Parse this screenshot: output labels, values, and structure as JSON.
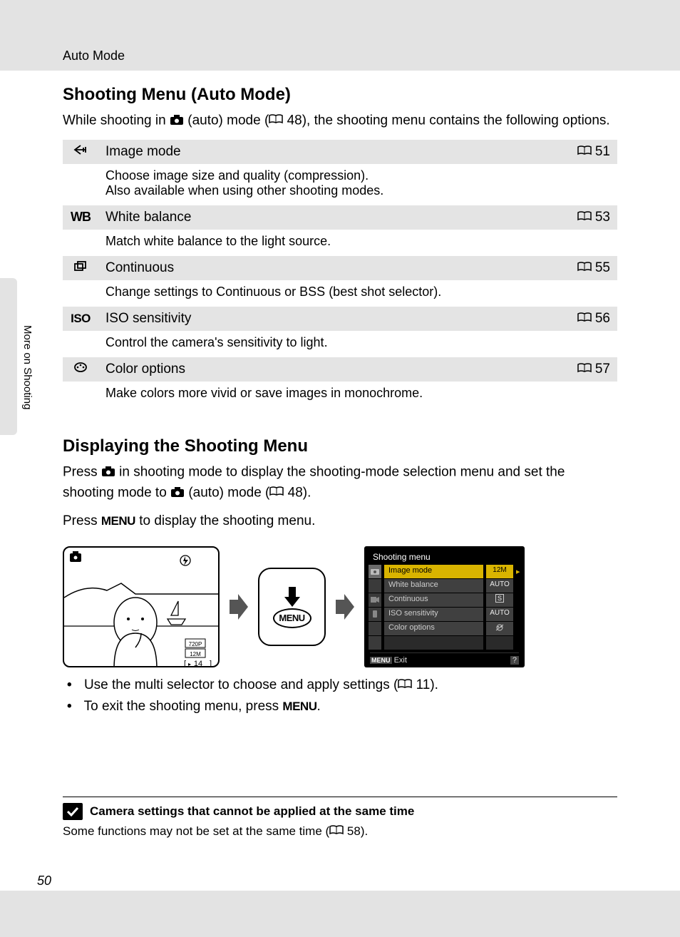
{
  "header": {
    "chapter": "Auto Mode"
  },
  "side_label": "More on Shooting",
  "page_number": "50",
  "section1": {
    "title": "Shooting Menu (Auto Mode)",
    "intro_pre": "While shooting in ",
    "intro_mid": " (auto) mode (",
    "intro_page": " 48), the shooting menu contains the following options.",
    "options": [
      {
        "icon": "image-mode-icon",
        "label": "Image mode",
        "page": "51",
        "desc": "Choose image size and quality (compression).\nAlso available when using other shooting modes."
      },
      {
        "icon": "WB",
        "label": "White balance",
        "page": "53",
        "desc": "Match white balance to the light source."
      },
      {
        "icon": "continuous-icon",
        "label": "Continuous",
        "page": "55",
        "desc": "Change settings to Continuous or BSS (best shot selector)."
      },
      {
        "icon": "ISO",
        "label": "ISO sensitivity",
        "page": "56",
        "desc": "Control the camera's sensitivity to light."
      },
      {
        "icon": "color-icon",
        "label": "Color options",
        "page": "57",
        "desc": "Make colors more vivid or save images in monochrome."
      }
    ]
  },
  "section2": {
    "title": "Displaying the Shooting Menu",
    "p1_a": "Press ",
    "p1_b": " in shooting mode to display the shooting-mode selection menu and set the shooting mode to ",
    "p1_c": " (auto) mode (",
    "p1_page": " 48).",
    "p2_a": "Press ",
    "p2_menu": "MENU",
    "p2_b": " to display the shooting menu.",
    "bullets": [
      {
        "text_a": "Use the multi selector to choose and apply settings (",
        "page": " 11).",
        "has_page": true
      },
      {
        "text_a": "To exit the shooting menu, press ",
        "menu": "MENU",
        "text_b": ".",
        "has_menu": true
      }
    ],
    "lcd": {
      "title": "Shooting menu",
      "rows": [
        {
          "label": "Image mode",
          "val": "12M",
          "active": true
        },
        {
          "label": "White balance",
          "val": "AUTO"
        },
        {
          "label": "Continuous",
          "val": "S"
        },
        {
          "label": "ISO sensitivity",
          "val": "AUTO"
        },
        {
          "label": "Color options",
          "val": "✕"
        }
      ],
      "footer_left": "MENU Exit",
      "footer_right": "?"
    },
    "live_overlay": {
      "counter": "14",
      "badge1": "720P",
      "badge2": "12M"
    }
  },
  "note": {
    "title": "Camera settings that cannot be applied at the same time",
    "body_a": "Some functions may not be set at the same time (",
    "body_page": " 58)."
  }
}
